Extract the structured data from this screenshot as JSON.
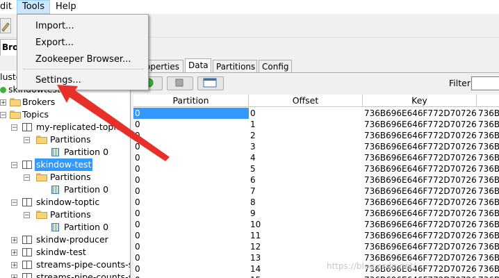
{
  "menubar": {
    "edit": "dit",
    "tools": "Tools",
    "help": "Help"
  },
  "top_tab": "Brow",
  "tools_menu": {
    "items": [
      "Import...",
      "Export...",
      "Zookeeper Browser...",
      "Settings..."
    ]
  },
  "left_pane": {
    "header": "luste",
    "cluster": "skindowtest",
    "rows": [
      {
        "label": "Brokers"
      },
      {
        "label": "Topics"
      },
      {
        "label": "my-replicated-topic"
      },
      {
        "label": "Partitions"
      },
      {
        "label": "Partition 0"
      },
      {
        "label": "skindow-test"
      },
      {
        "label": "Partitions"
      },
      {
        "label": "Partition 0"
      },
      {
        "label": "skindow-toptic"
      },
      {
        "label": "Partitions"
      },
      {
        "label": "Partition 0"
      },
      {
        "label": "skindw-producer"
      },
      {
        "label": "skindw-test"
      },
      {
        "label": "streams-pipe-counts-s"
      },
      {
        "label": "streams-pipe-counts-s"
      }
    ]
  },
  "right_tabs": [
    "operties",
    "Data",
    "Partitions",
    "Config"
  ],
  "filter_label": "Filter",
  "table": {
    "headers": [
      "Partition",
      "Offset",
      "Key",
      ""
    ],
    "rows": [
      [
        "0",
        "0",
        "736B696E646F772D70726...",
        "736B"
      ],
      [
        "0",
        "1",
        "736B696E646F772D70726...",
        "736B"
      ],
      [
        "0",
        "2",
        "736B696E646F772D70726...",
        "736B"
      ],
      [
        "0",
        "3",
        "736B696E646F772D70726...",
        "736B"
      ],
      [
        "0",
        "4",
        "736B696E646F772D70726...",
        "736B"
      ],
      [
        "0",
        "5",
        "736B696E646F772D70726...",
        "736B"
      ],
      [
        "0",
        "6",
        "736B696E646F772D70726...",
        "736B"
      ],
      [
        "0",
        "7",
        "736B696E646F772D70726...",
        "736B"
      ],
      [
        "0",
        "8",
        "736B696E646F772D70726...",
        "736B"
      ],
      [
        "0",
        "9",
        "736B696E646F772D70726...",
        "736B"
      ],
      [
        "0",
        "10",
        "736B696E646F772D70726...",
        "736B"
      ],
      [
        "0",
        "11",
        "736B696E646F772D70726...",
        "736B"
      ],
      [
        "0",
        "12",
        "736B696E646F772D70726...",
        "736B"
      ],
      [
        "0",
        "13",
        "736B696E646F772D70726...",
        "736B"
      ],
      [
        "0",
        "14",
        "736B696E646F772D70726...",
        "736B"
      ],
      [
        "0",
        "15",
        "736B696E646F772D70726...",
        "736B"
      ]
    ]
  },
  "watermark": "https://blog.csdn.net/",
  "colors": {
    "selection": "#3399ff",
    "arrow": "#e8302a",
    "menu_highlight": "#cce8ff"
  }
}
